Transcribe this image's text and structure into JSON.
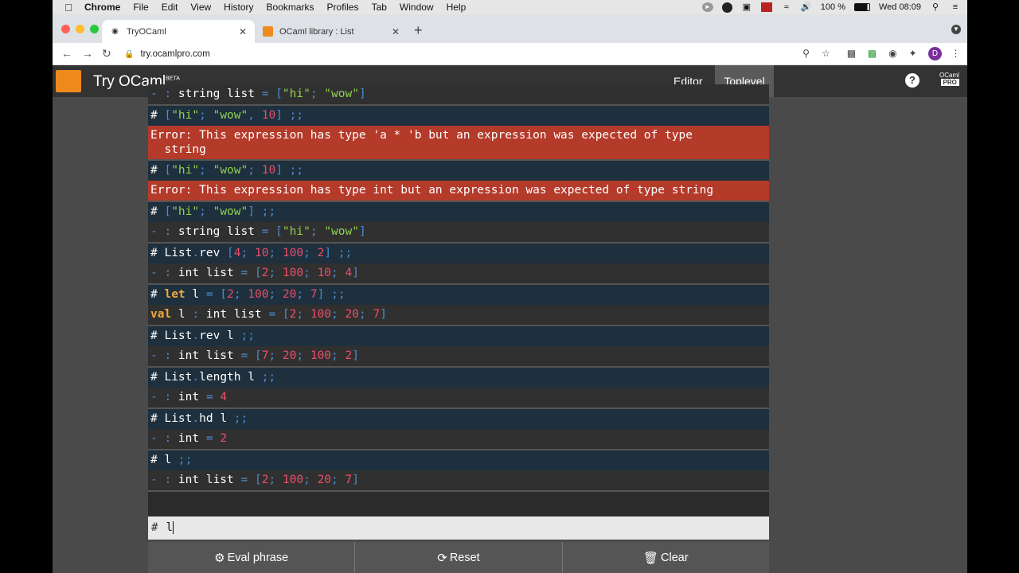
{
  "menubar": {
    "app": "Chrome",
    "items": [
      "File",
      "Edit",
      "View",
      "History",
      "Bookmarks",
      "Profiles",
      "Tab",
      "Window",
      "Help"
    ],
    "battery": "100 %",
    "clock": "Wed 08:09"
  },
  "tabs": [
    {
      "title": "TryOCaml",
      "active": true
    },
    {
      "title": "OCaml library : List",
      "active": false
    }
  ],
  "address": {
    "url": "try.ocamlpro.com"
  },
  "profile": {
    "initial": "D"
  },
  "app": {
    "title": "Try OCaml",
    "beta": "BETA",
    "nav_editor": "Editor",
    "nav_toplevel": "Toplevel",
    "help": "?",
    "brand_top": "OCaml",
    "brand_bottom": "PRO"
  },
  "console": {
    "entries": [
      {
        "lines": [
          {
            "type": "output",
            "parts": [
              [
                "p",
                "- : "
              ],
              [
                "t",
                "string list "
              ],
              [
                "p",
                "= ["
              ],
              [
                "s",
                "\"hi\""
              ],
              [
                "p",
                "; "
              ],
              [
                "s",
                "\"wow\""
              ],
              [
                "p",
                "]"
              ]
            ]
          }
        ]
      },
      {
        "lines": [
          {
            "type": "input",
            "parts": [
              [
                "t",
                "# "
              ],
              [
                "p",
                "["
              ],
              [
                "s",
                "\"hi\""
              ],
              [
                "p",
                "; "
              ],
              [
                "s",
                "\"wow\""
              ],
              [
                "p",
                ", "
              ],
              [
                "n",
                "10"
              ],
              [
                "p",
                "] ;;"
              ]
            ]
          },
          {
            "type": "error",
            "parts": [
              [
                "t",
                "Error: This expression has type 'a * 'b but an expression was expected of type\n  string"
              ]
            ]
          }
        ]
      },
      {
        "lines": [
          {
            "type": "input",
            "parts": [
              [
                "t",
                "# "
              ],
              [
                "p",
                "["
              ],
              [
                "s",
                "\"hi\""
              ],
              [
                "p",
                "; "
              ],
              [
                "s",
                "\"wow\""
              ],
              [
                "p",
                "; "
              ],
              [
                "n",
                "10"
              ],
              [
                "p",
                "] ;;"
              ]
            ]
          },
          {
            "type": "error",
            "parts": [
              [
                "t",
                "Error: This expression has type int but an expression was expected of type string"
              ]
            ]
          }
        ]
      },
      {
        "lines": [
          {
            "type": "input",
            "parts": [
              [
                "t",
                "# "
              ],
              [
                "p",
                "["
              ],
              [
                "s",
                "\"hi\""
              ],
              [
                "p",
                "; "
              ],
              [
                "s",
                "\"wow\""
              ],
              [
                "p",
                "] ;;"
              ]
            ]
          },
          {
            "type": "output",
            "parts": [
              [
                "p",
                "- : "
              ],
              [
                "t",
                "string list "
              ],
              [
                "p",
                "= ["
              ],
              [
                "s",
                "\"hi\""
              ],
              [
                "p",
                "; "
              ],
              [
                "s",
                "\"wow\""
              ],
              [
                "p",
                "]"
              ]
            ]
          }
        ]
      },
      {
        "lines": [
          {
            "type": "input",
            "parts": [
              [
                "t",
                "# List"
              ],
              [
                "p",
                "."
              ],
              [
                "t",
                "rev "
              ],
              [
                "p",
                "["
              ],
              [
                "n",
                "4"
              ],
              [
                "p",
                "; "
              ],
              [
                "n",
                "10"
              ],
              [
                "p",
                "; "
              ],
              [
                "n",
                "100"
              ],
              [
                "p",
                "; "
              ],
              [
                "n",
                "2"
              ],
              [
                "p",
                "] ;;"
              ]
            ]
          },
          {
            "type": "output",
            "parts": [
              [
                "p",
                "- : "
              ],
              [
                "t",
                "int list "
              ],
              [
                "p",
                "= ["
              ],
              [
                "n",
                "2"
              ],
              [
                "p",
                "; "
              ],
              [
                "n",
                "100"
              ],
              [
                "p",
                "; "
              ],
              [
                "n",
                "10"
              ],
              [
                "p",
                "; "
              ],
              [
                "n",
                "4"
              ],
              [
                "p",
                "]"
              ]
            ]
          }
        ]
      },
      {
        "lines": [
          {
            "type": "input",
            "parts": [
              [
                "t",
                "# "
              ],
              [
                "k",
                "let"
              ],
              [
                "t",
                " l "
              ],
              [
                "p",
                "= ["
              ],
              [
                "n",
                "2"
              ],
              [
                "p",
                "; "
              ],
              [
                "n",
                "100"
              ],
              [
                "p",
                "; "
              ],
              [
                "n",
                "20"
              ],
              [
                "p",
                "; "
              ],
              [
                "n",
                "7"
              ],
              [
                "p",
                "] ;;"
              ]
            ]
          },
          {
            "type": "output",
            "parts": [
              [
                "k",
                "val"
              ],
              [
                "t",
                " l "
              ],
              [
                "p",
                ": "
              ],
              [
                "t",
                "int list "
              ],
              [
                "p",
                "= ["
              ],
              [
                "n",
                "2"
              ],
              [
                "p",
                "; "
              ],
              [
                "n",
                "100"
              ],
              [
                "p",
                "; "
              ],
              [
                "n",
                "20"
              ],
              [
                "p",
                "; "
              ],
              [
                "n",
                "7"
              ],
              [
                "p",
                "]"
              ]
            ]
          }
        ]
      },
      {
        "lines": [
          {
            "type": "input",
            "parts": [
              [
                "t",
                "# List"
              ],
              [
                "p",
                "."
              ],
              [
                "t",
                "rev l "
              ],
              [
                "p",
                ";;"
              ]
            ]
          },
          {
            "type": "output",
            "parts": [
              [
                "p",
                "- : "
              ],
              [
                "t",
                "int list "
              ],
              [
                "p",
                "= ["
              ],
              [
                "n",
                "7"
              ],
              [
                "p",
                "; "
              ],
              [
                "n",
                "20"
              ],
              [
                "p",
                "; "
              ],
              [
                "n",
                "100"
              ],
              [
                "p",
                "; "
              ],
              [
                "n",
                "2"
              ],
              [
                "p",
                "]"
              ]
            ]
          }
        ]
      },
      {
        "lines": [
          {
            "type": "input",
            "parts": [
              [
                "t",
                "# List"
              ],
              [
                "p",
                "."
              ],
              [
                "t",
                "length l "
              ],
              [
                "p",
                ";;"
              ]
            ]
          },
          {
            "type": "output",
            "parts": [
              [
                "p",
                "- : "
              ],
              [
                "t",
                "int "
              ],
              [
                "p",
                "= "
              ],
              [
                "n",
                "4"
              ]
            ]
          }
        ]
      },
      {
        "lines": [
          {
            "type": "input",
            "parts": [
              [
                "t",
                "# List"
              ],
              [
                "p",
                "."
              ],
              [
                "t",
                "hd l "
              ],
              [
                "p",
                ";;"
              ]
            ]
          },
          {
            "type": "output",
            "parts": [
              [
                "p",
                "- : "
              ],
              [
                "t",
                "int "
              ],
              [
                "p",
                "= "
              ],
              [
                "n",
                "2"
              ]
            ]
          }
        ]
      },
      {
        "lines": [
          {
            "type": "input",
            "parts": [
              [
                "t",
                "# l "
              ],
              [
                "p",
                ";;"
              ]
            ]
          },
          {
            "type": "output",
            "parts": [
              [
                "p",
                "- : "
              ],
              [
                "t",
                "int list "
              ],
              [
                "p",
                "= ["
              ],
              [
                "n",
                "2"
              ],
              [
                "p",
                "; "
              ],
              [
                "n",
                "100"
              ],
              [
                "p",
                "; "
              ],
              [
                "n",
                "20"
              ],
              [
                "p",
                "; "
              ],
              [
                "n",
                "7"
              ],
              [
                "p",
                "]"
              ]
            ]
          }
        ]
      }
    ]
  },
  "input": {
    "prompt": "#",
    "value": "l"
  },
  "actions": {
    "eval": "Eval phrase",
    "reset": "Reset",
    "clear": "Clear"
  }
}
